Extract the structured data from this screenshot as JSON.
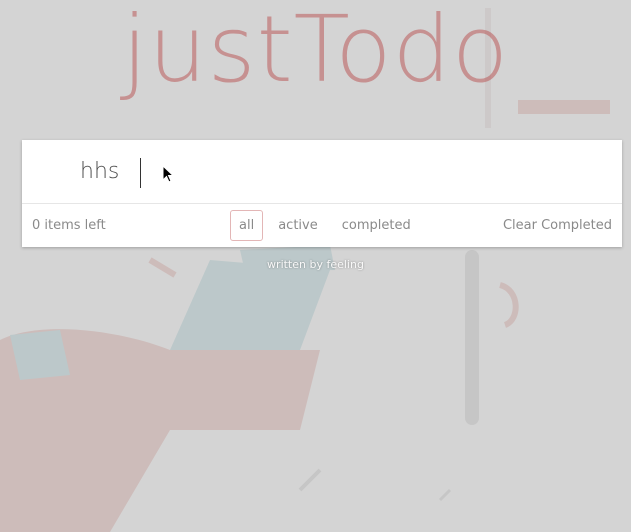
{
  "app": {
    "title": "justTodo"
  },
  "todo_input": {
    "value": "hhs"
  },
  "footer": {
    "count": "0 items left",
    "filters": [
      "all",
      "active",
      "completed"
    ],
    "selected_filter": "all",
    "clear": "Clear Completed"
  },
  "credit": "written by feeling",
  "colors": {
    "accent": "#b95a5a",
    "background": "#d4d4d4"
  },
  "icons": {
    "cursor": "mouse-pointer-icon"
  }
}
